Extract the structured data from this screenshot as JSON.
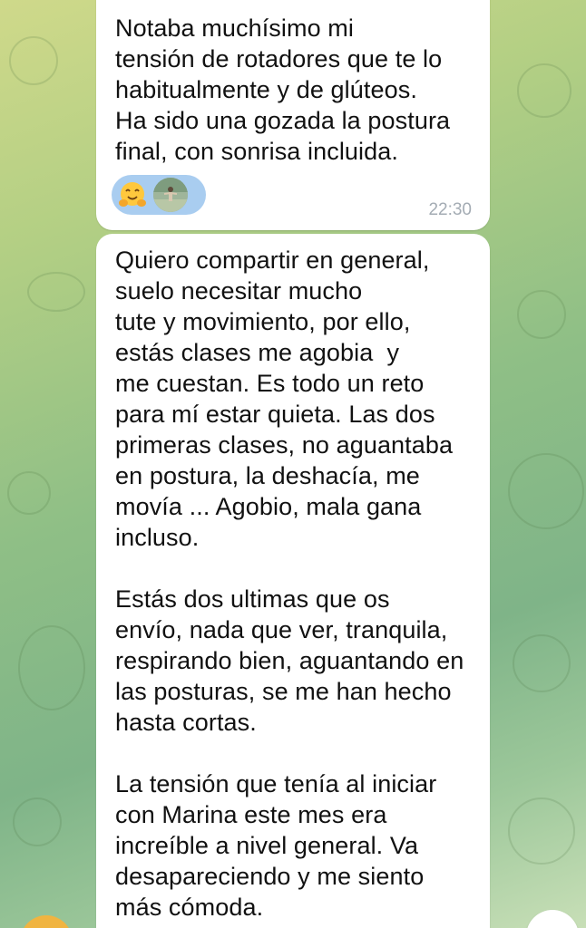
{
  "messages": [
    {
      "text": "Notaba muchísimo mi\ntensión de rotadores que te lo\nhabitualmente y de glúteos.\nHa sido una gozada la postura\nfinal, con sonrisa incluida.",
      "time": "22:30",
      "reactions": [
        {
          "emoji": "🤗",
          "name": "hugging-face"
        }
      ]
    },
    {
      "text": "Quiero compartir en general,\nsuelo necesitar mucho\ntute y movimiento, por ello,\nestás clases me agobia  y\nme cuestan. Es todo un reto\npara mí estar quieta. Las dos\nprimeras clases, no aguantaba\nen postura, la deshacía, me\nmovía ... Agobio, mala gana\nincluso.\n\nEstás dos ultimas que os\nenvío, nada que ver, tranquila,\nrespirando bien, aguantando en\nlas posturas, se me han hecho\nhasta cortas.\n\nLa tensión que tenía al iniciar\ncon Marina este mes era\nincreíble a nivel general. Va\ndesapareciendo y me siento\nmás cómoda."
    }
  ],
  "colors": {
    "bubble": "#ffffff",
    "reaction_pill": "#a9cdf0",
    "timestamp": "#a4acb4",
    "background_top": "#cfd98a",
    "background_bottom": "#7fb488"
  }
}
